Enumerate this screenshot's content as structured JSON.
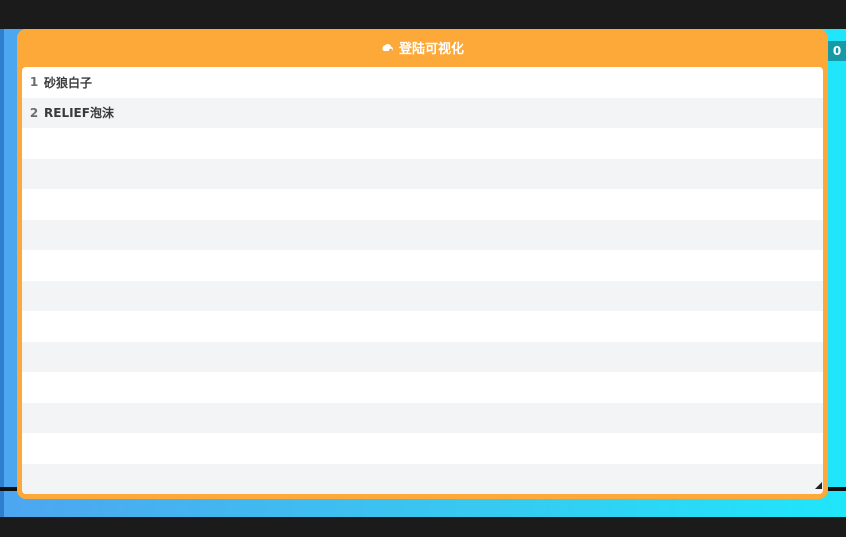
{
  "window": {
    "title": "登陆可视化",
    "title_icon": "cloud-user-icon",
    "side_badge": "0"
  },
  "list": {
    "rows": [
      {
        "index": "1",
        "name": "砂狼白子"
      },
      {
        "index": "2",
        "name": "RELIEF泡沫"
      }
    ],
    "empty_rows": 12
  },
  "colors": {
    "panel": "#fca93a",
    "backdrop_left": "#4da6f0",
    "backdrop_right": "#1fe6fb",
    "row_alt": "#f3f4f6",
    "badge": "#169aa6"
  }
}
